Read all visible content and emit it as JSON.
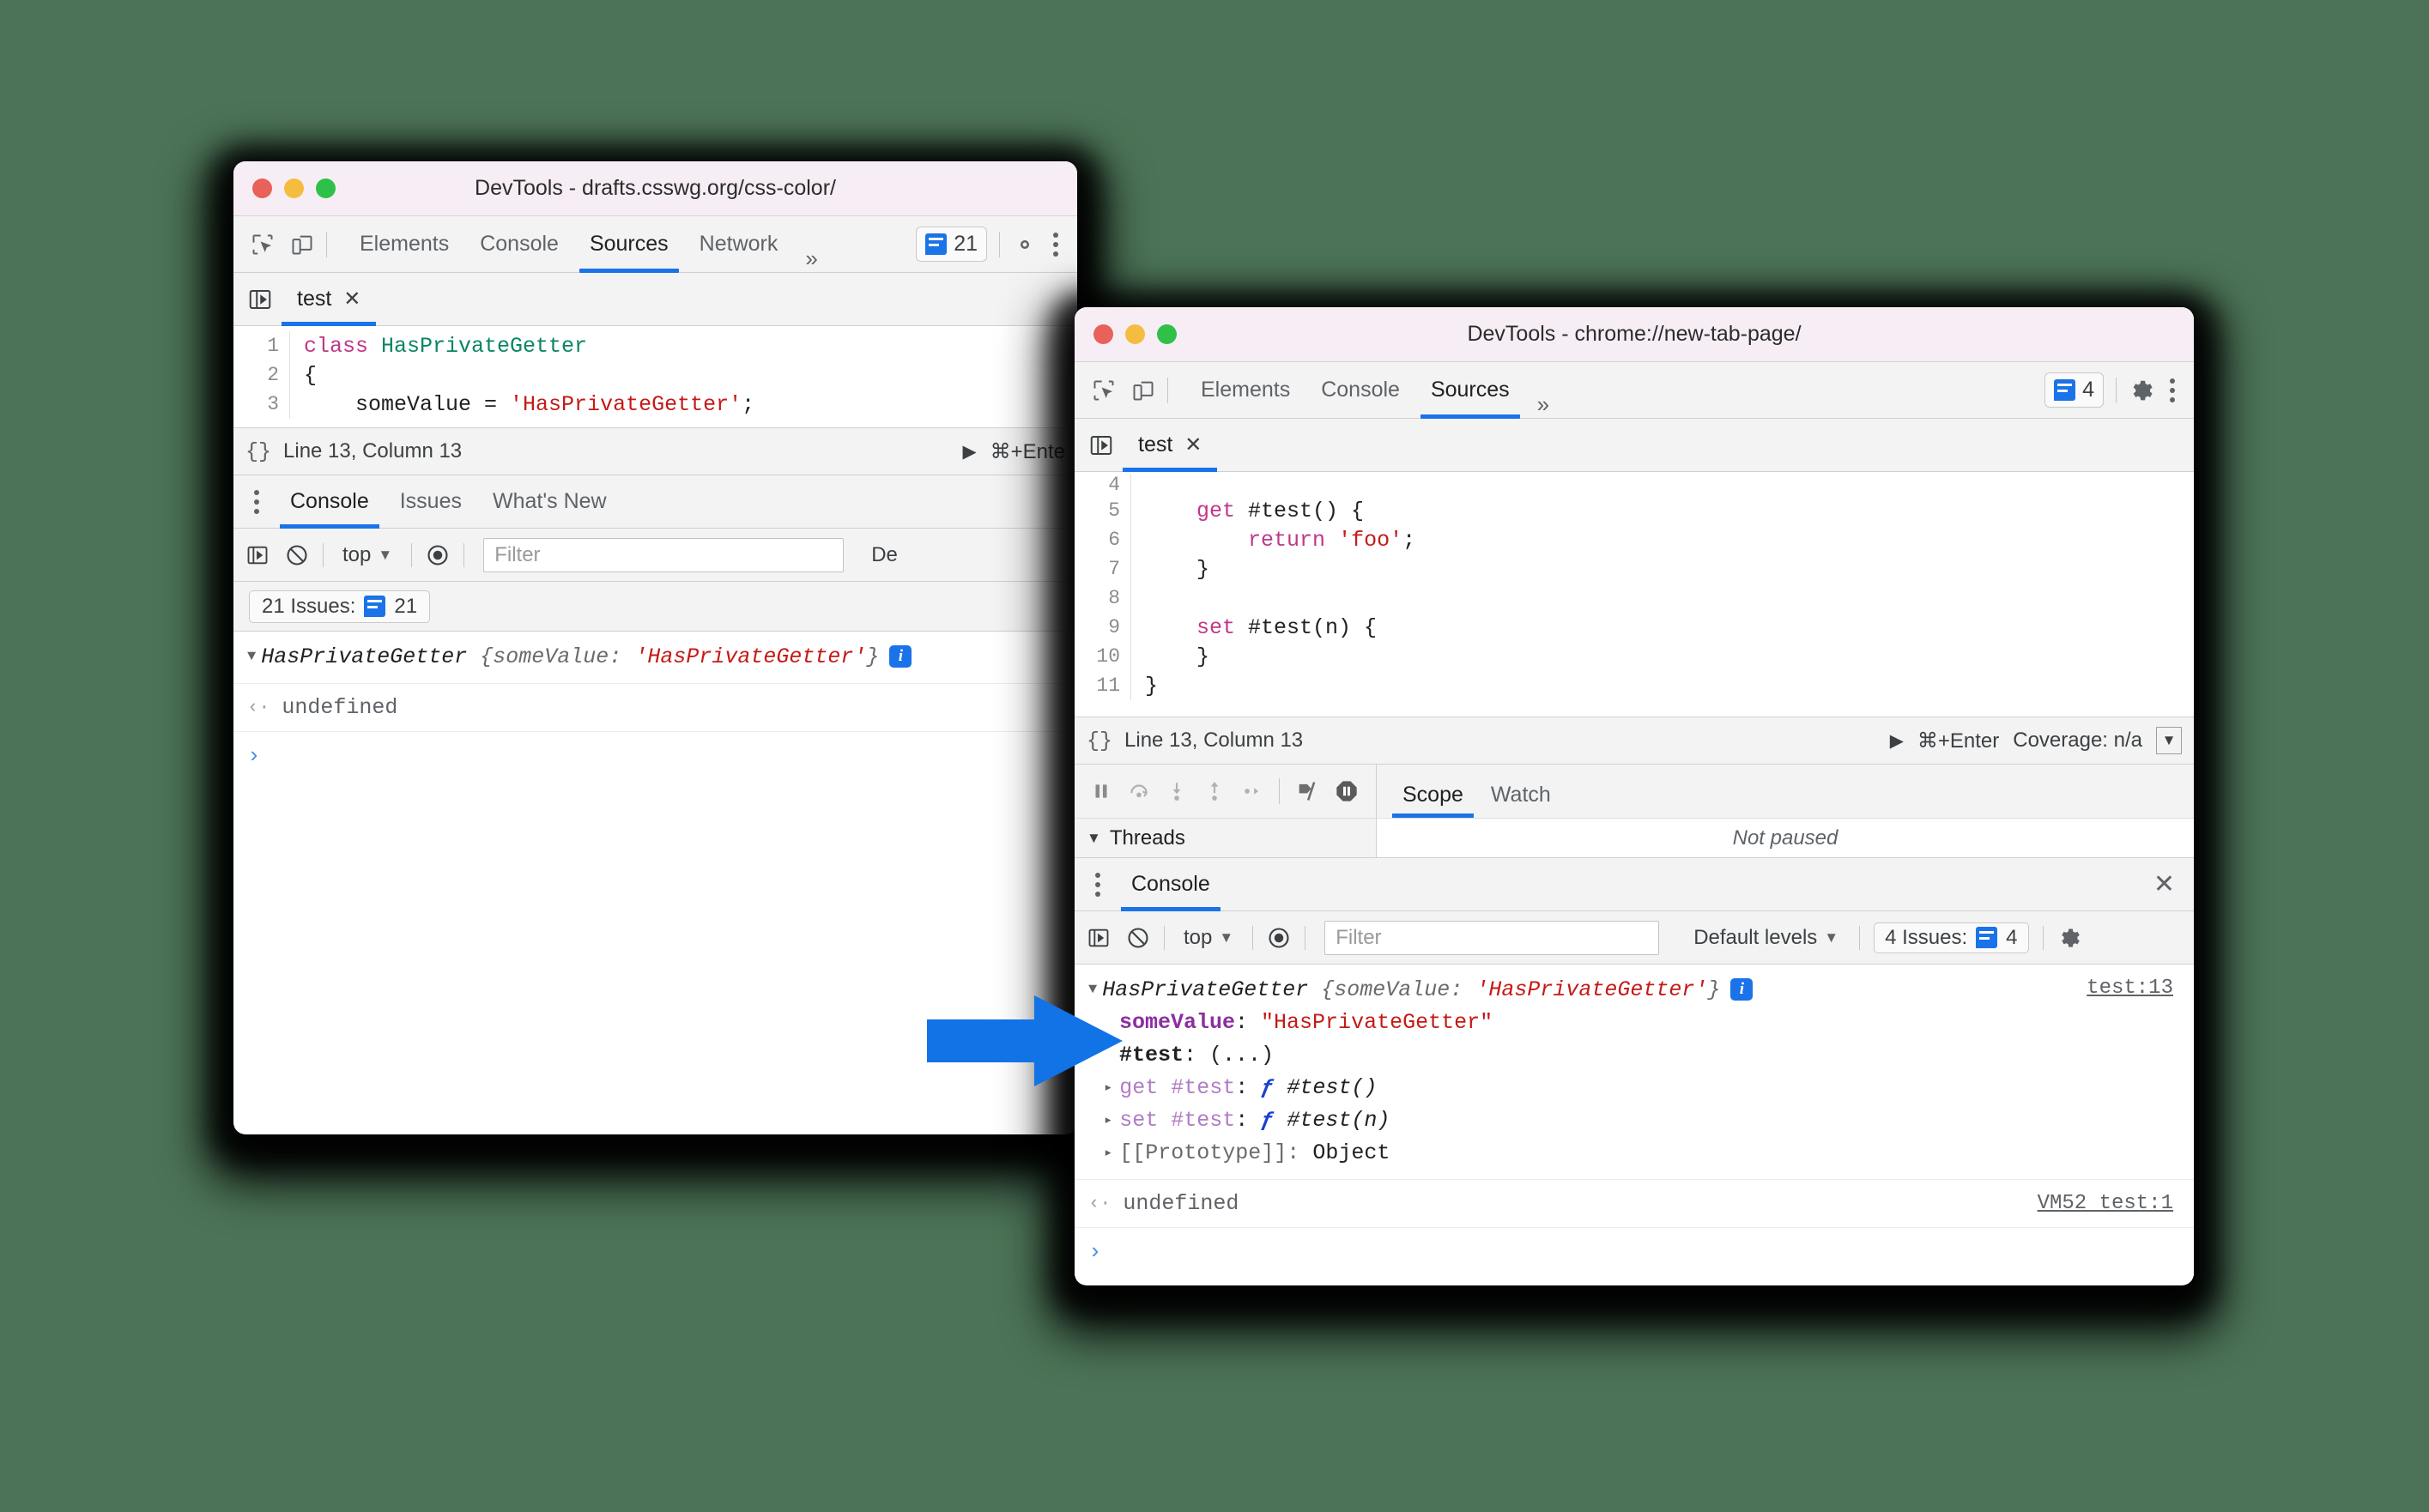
{
  "background_color": "#4c7357",
  "accent_color": "#1a73e8",
  "annotation": {
    "arrow_color": "#1273e6",
    "name": "blue-right-arrow"
  },
  "back_window": {
    "title": "DevTools - drafts.csswg.org/css-color/",
    "traffic_lights": [
      "close",
      "minimize",
      "maximize"
    ],
    "toolbar": {
      "inspect_icon": "inspect-element-icon",
      "device_icon": "device-toolbar-icon",
      "tabs": [
        {
          "label": "Elements",
          "active": false
        },
        {
          "label": "Console",
          "active": false
        },
        {
          "label": "Sources",
          "active": true
        },
        {
          "label": "Network",
          "active": false
        }
      ],
      "more_tabs_icon": "chevron-double-right-icon",
      "issues_count": "21",
      "settings_icon": "gear-icon",
      "more_icon": "kebab-menu-icon"
    },
    "sources": {
      "navigator_icon": "show-navigator-icon",
      "file_tab": {
        "label": "test",
        "close": "✕"
      },
      "code_lines": [
        {
          "num": "1",
          "tokens": [
            {
              "t": "class ",
              "c": "kw"
            },
            {
              "t": "HasPrivateGetter",
              "c": "cls"
            }
          ]
        },
        {
          "num": "2",
          "tokens": [
            {
              "t": "{",
              "c": ""
            }
          ]
        },
        {
          "num": "3",
          "tokens": [
            {
              "t": "    someValue = ",
              "c": ""
            },
            {
              "t": "'HasPrivateGetter'",
              "c": "str"
            },
            {
              "t": ";",
              "c": ""
            }
          ]
        }
      ]
    },
    "status_bar": {
      "braces_icon": "{}",
      "position": "Line 13, Column 13",
      "run_icon": "play-icon",
      "run_shortcut": "⌘+Ente"
    },
    "drawer": {
      "kebab_icon": "kebab-menu-icon",
      "tabs": [
        {
          "label": "Console",
          "active": true
        },
        {
          "label": "Issues",
          "active": false
        },
        {
          "label": "What's New",
          "active": false
        }
      ]
    },
    "console_toolbar": {
      "sidebar_icon": "show-console-sidebar-icon",
      "clear_icon": "clear-console-icon",
      "context": "top",
      "eye_icon": "live-expression-icon",
      "filter_placeholder": "Filter",
      "levels_partial": "De"
    },
    "issues_bar": {
      "label": "21 Issues:",
      "count": "21",
      "badge_icon": "issue-badge-icon"
    },
    "console_output": {
      "object_row": {
        "disclosure": "▼",
        "constructor": "HasPrivateGetter",
        "preview_open": "{",
        "preview_key": "someValue",
        "preview_colon": ": ",
        "preview_value": "'HasPrivateGetter'",
        "preview_close": "}",
        "info_icon": "info-icon"
      },
      "result_row": {
        "marker": "‹·",
        "text": "undefined"
      },
      "prompt": "›"
    }
  },
  "front_window": {
    "title": "DevTools - chrome://new-tab-page/",
    "traffic_lights": [
      "close",
      "minimize",
      "maximize"
    ],
    "toolbar": {
      "inspect_icon": "inspect-element-icon",
      "device_icon": "device-toolbar-icon",
      "tabs": [
        {
          "label": "Elements",
          "active": false
        },
        {
          "label": "Console",
          "active": false
        },
        {
          "label": "Sources",
          "active": true
        }
      ],
      "more_tabs_icon": "chevron-double-right-icon",
      "issues_count": "4",
      "settings_icon": "gear-icon",
      "more_icon": "kebab-menu-icon"
    },
    "sources": {
      "navigator_icon": "show-navigator-icon",
      "file_tab": {
        "label": "test",
        "close": "✕"
      },
      "code_lines": [
        {
          "num": "4",
          "tokens": [
            {
              "t": "",
              "c": ""
            }
          ]
        },
        {
          "num": "5",
          "tokens": [
            {
              "t": "    ",
              "c": ""
            },
            {
              "t": "get",
              "c": "kw"
            },
            {
              "t": " #test() {",
              "c": ""
            }
          ]
        },
        {
          "num": "6",
          "tokens": [
            {
              "t": "        ",
              "c": ""
            },
            {
              "t": "return",
              "c": "kw"
            },
            {
              "t": " ",
              "c": ""
            },
            {
              "t": "'foo'",
              "c": "str"
            },
            {
              "t": ";",
              "c": ""
            }
          ]
        },
        {
          "num": "7",
          "tokens": [
            {
              "t": "    }",
              "c": ""
            }
          ]
        },
        {
          "num": "8",
          "tokens": [
            {
              "t": "",
              "c": ""
            }
          ]
        },
        {
          "num": "9",
          "tokens": [
            {
              "t": "    ",
              "c": ""
            },
            {
              "t": "set",
              "c": "kw"
            },
            {
              "t": " #test(n) {",
              "c": ""
            }
          ]
        },
        {
          "num": "10",
          "tokens": [
            {
              "t": "    }",
              "c": ""
            }
          ]
        },
        {
          "num": "11",
          "tokens": [
            {
              "t": "}",
              "c": ""
            }
          ]
        }
      ]
    },
    "status_bar": {
      "braces_icon": "{}",
      "position": "Line 13, Column 13",
      "run_icon": "play-icon",
      "run_shortcut": "⌘+Enter",
      "coverage": "Coverage: n/a",
      "collapse_icon": "collapse-pane-icon"
    },
    "debugger": {
      "buttons": [
        {
          "name": "pause-resume-icon"
        },
        {
          "name": "step-over-icon"
        },
        {
          "name": "step-into-icon"
        },
        {
          "name": "step-out-icon"
        },
        {
          "name": "step-icon"
        },
        {
          "name": "deactivate-breakpoints-icon"
        },
        {
          "name": "pause-on-exceptions-icon"
        }
      ],
      "threads_label": "Threads",
      "threads_disclosure": "▼",
      "side_tabs": [
        {
          "label": "Scope",
          "active": true
        },
        {
          "label": "Watch",
          "active": false
        }
      ],
      "scope_empty": "Not paused"
    },
    "drawer": {
      "kebab_icon": "kebab-menu-icon",
      "tabs": [
        {
          "label": "Console",
          "active": true
        }
      ],
      "close_icon": "close-icon"
    },
    "console_toolbar": {
      "sidebar_icon": "show-console-sidebar-icon",
      "clear_icon": "clear-console-icon",
      "context": "top",
      "eye_icon": "live-expression-icon",
      "filter_placeholder": "Filter",
      "levels": "Default levels",
      "issues_label": "4 Issues:",
      "issues_count": "4",
      "settings_icon": "gear-icon"
    },
    "console_output": {
      "object_row": {
        "disclosure": "▼",
        "constructor": "HasPrivateGetter",
        "preview_open": "{",
        "preview_key": "someValue",
        "preview_colon": ": ",
        "preview_value": "'HasPrivateGetter'",
        "preview_close": "}",
        "info_icon": "info-icon",
        "source_link": "test:13"
      },
      "properties": [
        {
          "disclosure": "",
          "key": "someValue",
          "key_class": "purple-bold",
          "sep": ": ",
          "value": "\"HasPrivateGetter\"",
          "value_class": "red"
        },
        {
          "disclosure": "",
          "key": "#test",
          "key_class": "dark-bold",
          "sep": ": ",
          "value": "(...)",
          "value_class": "plain"
        },
        {
          "disclosure": "▸",
          "key": "get #test",
          "key_class": "lightpurple",
          "sep": ": ",
          "value_fn": "ƒ",
          "value": "#test()",
          "value_class": "italic"
        },
        {
          "disclosure": "▸",
          "key": "set #test",
          "key_class": "lightpurple",
          "sep": ": ",
          "value_fn": "ƒ",
          "value": "#test(n)",
          "value_class": "italic"
        },
        {
          "disclosure": "▸",
          "key": "[[Prototype]]",
          "key_class": "grey",
          "sep": ": ",
          "value": "Object",
          "value_class": "plain"
        }
      ],
      "result_row": {
        "marker": "‹·",
        "text": "undefined",
        "source_link": "VM52 test:1"
      },
      "prompt": "›"
    }
  }
}
